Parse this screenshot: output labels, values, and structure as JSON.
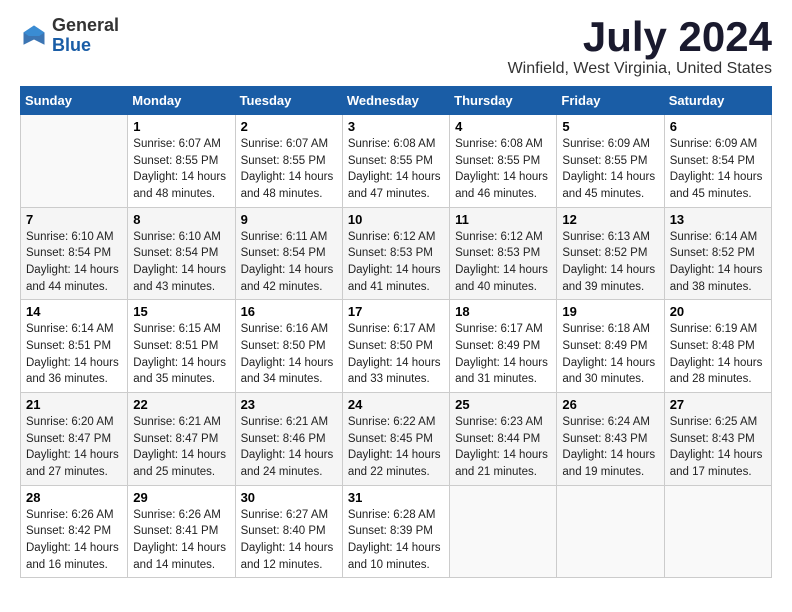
{
  "logo": {
    "general": "General",
    "blue": "Blue"
  },
  "title": {
    "month_year": "July 2024",
    "location": "Winfield, West Virginia, United States"
  },
  "days_of_week": [
    "Sunday",
    "Monday",
    "Tuesday",
    "Wednesday",
    "Thursday",
    "Friday",
    "Saturday"
  ],
  "weeks": [
    [
      {
        "day": "",
        "content": ""
      },
      {
        "day": "1",
        "content": "Sunrise: 6:07 AM\nSunset: 8:55 PM\nDaylight: 14 hours and 48 minutes."
      },
      {
        "day": "2",
        "content": "Sunrise: 6:07 AM\nSunset: 8:55 PM\nDaylight: 14 hours and 48 minutes."
      },
      {
        "day": "3",
        "content": "Sunrise: 6:08 AM\nSunset: 8:55 PM\nDaylight: 14 hours and 47 minutes."
      },
      {
        "day": "4",
        "content": "Sunrise: 6:08 AM\nSunset: 8:55 PM\nDaylight: 14 hours and 46 minutes."
      },
      {
        "day": "5",
        "content": "Sunrise: 6:09 AM\nSunset: 8:55 PM\nDaylight: 14 hours and 45 minutes."
      },
      {
        "day": "6",
        "content": "Sunrise: 6:09 AM\nSunset: 8:54 PM\nDaylight: 14 hours and 45 minutes."
      }
    ],
    [
      {
        "day": "7",
        "content": "Sunrise: 6:10 AM\nSunset: 8:54 PM\nDaylight: 14 hours and 44 minutes."
      },
      {
        "day": "8",
        "content": "Sunrise: 6:10 AM\nSunset: 8:54 PM\nDaylight: 14 hours and 43 minutes."
      },
      {
        "day": "9",
        "content": "Sunrise: 6:11 AM\nSunset: 8:54 PM\nDaylight: 14 hours and 42 minutes."
      },
      {
        "day": "10",
        "content": "Sunrise: 6:12 AM\nSunset: 8:53 PM\nDaylight: 14 hours and 41 minutes."
      },
      {
        "day": "11",
        "content": "Sunrise: 6:12 AM\nSunset: 8:53 PM\nDaylight: 14 hours and 40 minutes."
      },
      {
        "day": "12",
        "content": "Sunrise: 6:13 AM\nSunset: 8:52 PM\nDaylight: 14 hours and 39 minutes."
      },
      {
        "day": "13",
        "content": "Sunrise: 6:14 AM\nSunset: 8:52 PM\nDaylight: 14 hours and 38 minutes."
      }
    ],
    [
      {
        "day": "14",
        "content": "Sunrise: 6:14 AM\nSunset: 8:51 PM\nDaylight: 14 hours and 36 minutes."
      },
      {
        "day": "15",
        "content": "Sunrise: 6:15 AM\nSunset: 8:51 PM\nDaylight: 14 hours and 35 minutes."
      },
      {
        "day": "16",
        "content": "Sunrise: 6:16 AM\nSunset: 8:50 PM\nDaylight: 14 hours and 34 minutes."
      },
      {
        "day": "17",
        "content": "Sunrise: 6:17 AM\nSunset: 8:50 PM\nDaylight: 14 hours and 33 minutes."
      },
      {
        "day": "18",
        "content": "Sunrise: 6:17 AM\nSunset: 8:49 PM\nDaylight: 14 hours and 31 minutes."
      },
      {
        "day": "19",
        "content": "Sunrise: 6:18 AM\nSunset: 8:49 PM\nDaylight: 14 hours and 30 minutes."
      },
      {
        "day": "20",
        "content": "Sunrise: 6:19 AM\nSunset: 8:48 PM\nDaylight: 14 hours and 28 minutes."
      }
    ],
    [
      {
        "day": "21",
        "content": "Sunrise: 6:20 AM\nSunset: 8:47 PM\nDaylight: 14 hours and 27 minutes."
      },
      {
        "day": "22",
        "content": "Sunrise: 6:21 AM\nSunset: 8:47 PM\nDaylight: 14 hours and 25 minutes."
      },
      {
        "day": "23",
        "content": "Sunrise: 6:21 AM\nSunset: 8:46 PM\nDaylight: 14 hours and 24 minutes."
      },
      {
        "day": "24",
        "content": "Sunrise: 6:22 AM\nSunset: 8:45 PM\nDaylight: 14 hours and 22 minutes."
      },
      {
        "day": "25",
        "content": "Sunrise: 6:23 AM\nSunset: 8:44 PM\nDaylight: 14 hours and 21 minutes."
      },
      {
        "day": "26",
        "content": "Sunrise: 6:24 AM\nSunset: 8:43 PM\nDaylight: 14 hours and 19 minutes."
      },
      {
        "day": "27",
        "content": "Sunrise: 6:25 AM\nSunset: 8:43 PM\nDaylight: 14 hours and 17 minutes."
      }
    ],
    [
      {
        "day": "28",
        "content": "Sunrise: 6:26 AM\nSunset: 8:42 PM\nDaylight: 14 hours and 16 minutes."
      },
      {
        "day": "29",
        "content": "Sunrise: 6:26 AM\nSunset: 8:41 PM\nDaylight: 14 hours and 14 minutes."
      },
      {
        "day": "30",
        "content": "Sunrise: 6:27 AM\nSunset: 8:40 PM\nDaylight: 14 hours and 12 minutes."
      },
      {
        "day": "31",
        "content": "Sunrise: 6:28 AM\nSunset: 8:39 PM\nDaylight: 14 hours and 10 minutes."
      },
      {
        "day": "",
        "content": ""
      },
      {
        "day": "",
        "content": ""
      },
      {
        "day": "",
        "content": ""
      }
    ]
  ]
}
